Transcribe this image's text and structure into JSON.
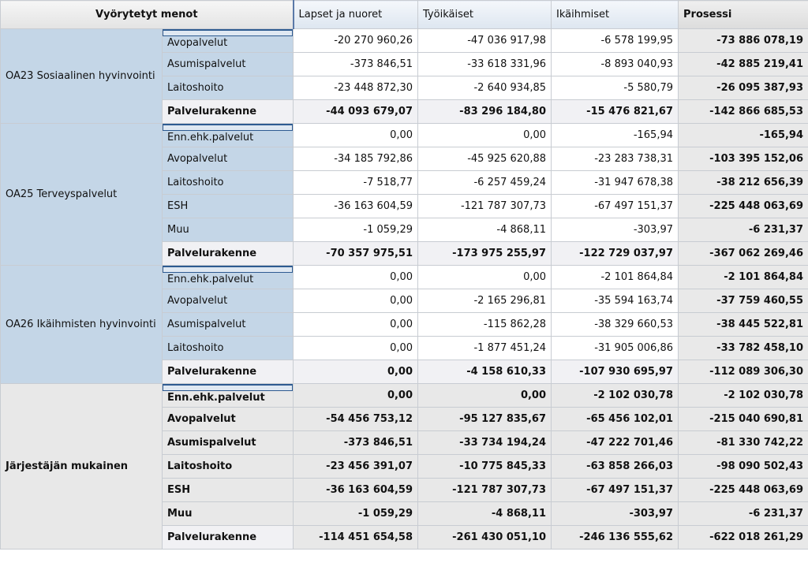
{
  "header": {
    "corner": "Vyörytetyt menot",
    "columns": [
      "Lapset ja nuoret",
      "Työikäiset",
      "Ikäihmiset",
      "Prosessi"
    ]
  },
  "groups": [
    {
      "label": "OA23 Sosiaalinen hyvinvointi",
      "rows": [
        {
          "label": "Avopalvelut",
          "values": [
            "-20 270 960,26",
            "-47 036 917,98",
            "-6 578 199,95",
            "-73 886 078,19"
          ]
        },
        {
          "label": "Asumispalvelut",
          "values": [
            "-373 846,51",
            "-33 618 331,96",
            "-8 893 040,93",
            "-42 885 219,41"
          ]
        },
        {
          "label": "Laitoshoito",
          "values": [
            "-23 448 872,30",
            "-2 640 934,85",
            "-5 580,79",
            "-26 095 387,93"
          ]
        },
        {
          "label": "Palvelurakenne",
          "values": [
            "-44 093 679,07",
            "-83 296 184,80",
            "-15 476 821,67",
            "-142 866 685,53"
          ]
        }
      ]
    },
    {
      "label": "OA25 Terveyspalvelut",
      "rows": [
        {
          "label": "Enn.ehk.palvelut",
          "values": [
            "0,00",
            "0,00",
            "-165,94",
            "-165,94"
          ]
        },
        {
          "label": "Avopalvelut",
          "values": [
            "-34 185 792,86",
            "-45 925 620,88",
            "-23 283 738,31",
            "-103 395 152,06"
          ]
        },
        {
          "label": "Laitoshoito",
          "values": [
            "-7 518,77",
            "-6 257 459,24",
            "-31 947 678,38",
            "-38 212 656,39"
          ]
        },
        {
          "label": "ESH",
          "values": [
            "-36 163 604,59",
            "-121 787 307,73",
            "-67 497 151,37",
            "-225 448 063,69"
          ]
        },
        {
          "label": "Muu",
          "values": [
            "-1 059,29",
            "-4 868,11",
            "-303,97",
            "-6 231,37"
          ]
        },
        {
          "label": "Palvelurakenne",
          "values": [
            "-70 357 975,51",
            "-173 975 255,97",
            "-122 729 037,97",
            "-367 062 269,46"
          ]
        }
      ]
    },
    {
      "label": "OA26 Ikäihmisten hyvinvointi",
      "rows": [
        {
          "label": "Enn.ehk.palvelut",
          "values": [
            "0,00",
            "0,00",
            "-2 101 864,84",
            "-2 101 864,84"
          ]
        },
        {
          "label": "Avopalvelut",
          "values": [
            "0,00",
            "-2 165 296,81",
            "-35 594 163,74",
            "-37 759 460,55"
          ]
        },
        {
          "label": "Asumispalvelut",
          "values": [
            "0,00",
            "-115 862,28",
            "-38 329 660,53",
            "-38 445 522,81"
          ]
        },
        {
          "label": "Laitoshoito",
          "values": [
            "0,00",
            "-1 877 451,24",
            "-31 905 006,86",
            "-33 782 458,10"
          ]
        },
        {
          "label": "Palvelurakenne",
          "values": [
            "0,00",
            "-4 158 610,33",
            "-107 930 695,97",
            "-112 089 306,30"
          ]
        }
      ]
    },
    {
      "label": "Järjestäjän mukainen",
      "rows": [
        {
          "label": "Enn.ehk.palvelut",
          "values": [
            "0,00",
            "0,00",
            "-2 102 030,78",
            "-2 102 030,78"
          ]
        },
        {
          "label": "Avopalvelut",
          "values": [
            "-54 456 753,12",
            "-95 127 835,67",
            "-65 456 102,01",
            "-215 040 690,81"
          ]
        },
        {
          "label": "Asumispalvelut",
          "values": [
            "-373 846,51",
            "-33 734 194,24",
            "-47 222 701,46",
            "-81 330 742,22"
          ]
        },
        {
          "label": "Laitoshoito",
          "values": [
            "-23 456 391,07",
            "-10 775 845,33",
            "-63 858 266,03",
            "-98 090 502,43"
          ]
        },
        {
          "label": "ESH",
          "values": [
            "-36 163 604,59",
            "-121 787 307,73",
            "-67 497 151,37",
            "-225 448 063,69"
          ]
        },
        {
          "label": "Muu",
          "values": [
            "-1 059,29",
            "-4 868,11",
            "-303,97",
            "-6 231,37"
          ]
        },
        {
          "label": "Palvelurakenne",
          "values": [
            "-114 451 654,58",
            "-261 430 051,10",
            "-246 136 555,62",
            "-622 018 261,29"
          ]
        }
      ]
    }
  ]
}
